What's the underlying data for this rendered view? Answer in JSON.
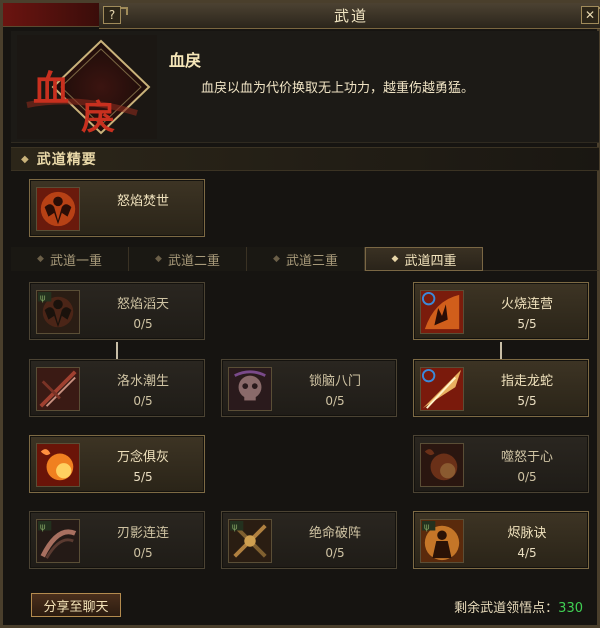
{
  "window": {
    "title": "武道",
    "help_glyph": "?",
    "close_glyph": "✕"
  },
  "header": {
    "emblem_text": "血戾",
    "skill_name": "血戾",
    "skill_desc": "血戾以血为代价换取无上功力，越重伤越勇猛。"
  },
  "essentials": {
    "label": "武道精要",
    "card": {
      "name": "怒焰焚世"
    }
  },
  "tabs": [
    {
      "label": "武道一重"
    },
    {
      "label": "武道二重"
    },
    {
      "label": "武道三重"
    },
    {
      "label": "武道四重",
      "active": true
    }
  ],
  "skills": [
    {
      "name": "怒焰滔天",
      "level": "0/5",
      "active": false,
      "icon": "muscle-fire-icon"
    },
    {
      "name": "火烧连营",
      "level": "5/5",
      "active": true,
      "icon": "fire-hand-icon"
    },
    {
      "name": "洛水潮生",
      "level": "0/5",
      "active": false,
      "icon": "blade-slash-icon"
    },
    {
      "name": "锁脑八门",
      "level": "0/5",
      "active": false,
      "icon": "skull-icon"
    },
    {
      "name": "指走龙蛇",
      "level": "5/5",
      "active": true,
      "icon": "sword-streak-icon"
    },
    {
      "name": "万念俱灰",
      "level": "5/5",
      "active": true,
      "icon": "fire-burst-icon"
    },
    {
      "name": "噬怒于心",
      "level": "0/5",
      "active": false,
      "icon": "fire-burst-icon"
    },
    {
      "name": "刃影连连",
      "level": "0/5",
      "active": false,
      "icon": "whirl-blade-icon"
    },
    {
      "name": "绝命破阵",
      "level": "0/5",
      "active": false,
      "icon": "crossed-weapons-icon"
    },
    {
      "name": "烬脉诀",
      "level": "4/5",
      "active": true,
      "icon": "aura-warrior-icon"
    }
  ],
  "footer": {
    "share_label": "分享至聊天",
    "remain_label": "剩余武道领悟点：",
    "remain_value": "330"
  },
  "colors": {
    "accent_gold": "#e9d8a8",
    "points_green": "#3fcf53",
    "emblem_red": "#b52a1c"
  }
}
